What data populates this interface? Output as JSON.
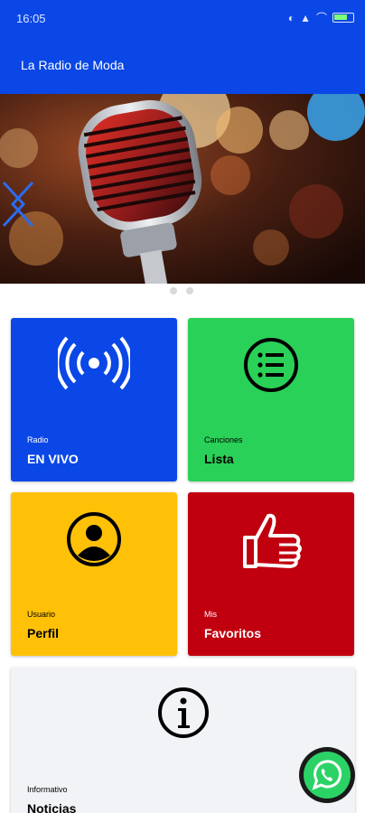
{
  "status_bar": {
    "time": "16:05"
  },
  "app_bar": {
    "title": "La Radio de Moda"
  },
  "tiles": [
    {
      "small": "Radio",
      "big": "EN VIVO",
      "color": "#0a47e6",
      "text_color": "#ffffff"
    },
    {
      "small": "Canciones",
      "big": "Lista",
      "color": "#2ad158",
      "text_color": "#000000"
    },
    {
      "small": "Usuario",
      "big": "Perfil",
      "color": "#ffc107",
      "text_color": "#000000"
    },
    {
      "small": "Mis",
      "big": "Favoritos",
      "color": "#c0000f",
      "text_color": "#ffffff"
    },
    {
      "small": "Informativo",
      "big": "Noticias",
      "color": "#f2f3f6",
      "text_color": "#000000"
    }
  ],
  "icons": {
    "tile_0": "radio-broadcast-icon",
    "tile_1": "list-icon",
    "tile_2": "user-profile-icon",
    "tile_3": "thumbs-up-icon",
    "tile_4": "info-icon",
    "fab": "whatsapp-icon"
  },
  "carousel": {
    "slide_count": 2,
    "active_index": 0
  }
}
